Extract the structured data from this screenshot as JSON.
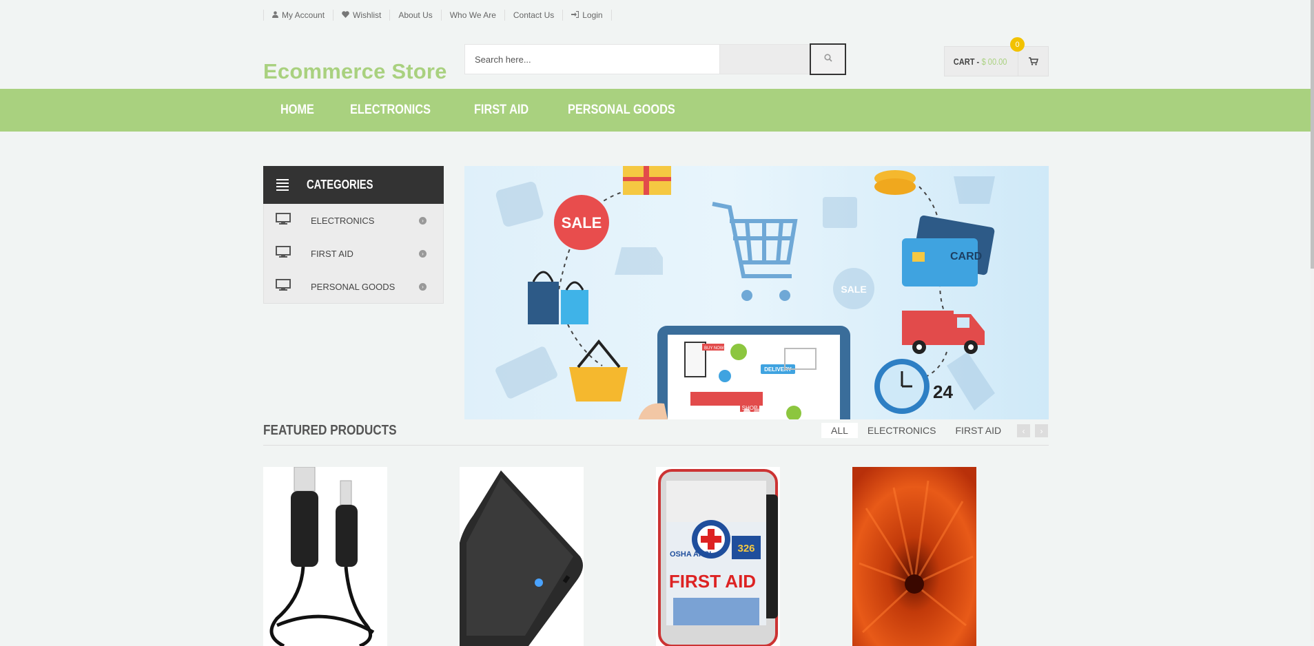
{
  "top_links": [
    {
      "label": "My Account",
      "icon": "user-icon"
    },
    {
      "label": "Wishlist",
      "icon": "heart-icon"
    },
    {
      "label": "About Us"
    },
    {
      "label": "Who We Are"
    },
    {
      "label": "Contact Us"
    },
    {
      "label": "Login",
      "icon": "sign-in-icon"
    }
  ],
  "header": {
    "logo": "Ecommerce Store",
    "search_placeholder": "Search here...",
    "cart_label": "CART -",
    "cart_amount": "$ 00.00",
    "cart_count": "0"
  },
  "nav": {
    "items": [
      "HOME",
      "ELECTRONICS",
      "FIRST AID",
      "PERSONAL GOODS"
    ]
  },
  "categories": {
    "title": "CATEGORIES",
    "items": [
      "ELECTRONICS",
      "FIRST AID",
      "PERSONAL GOODS"
    ]
  },
  "banner": {
    "sale1": "SALE",
    "sale2": "SALE",
    "card": "CARD",
    "delivery": "DELIVERY",
    "clock": "24",
    "buy_now": "BUY NOW",
    "shop": "SHOP"
  },
  "featured": {
    "title": "FEATURED PRODUCTS",
    "tabs": [
      "ALL",
      "ELECTRONICS",
      "FIRST AID"
    ],
    "prev": "‹",
    "next": "›",
    "first_aid_text": "FIRST AID",
    "first_aid_count": "326",
    "first_aid_osha": "OSHA ANSI"
  },
  "colors": {
    "accent": "#a9d17f",
    "dark": "#333333",
    "badge": "#f2c200"
  }
}
